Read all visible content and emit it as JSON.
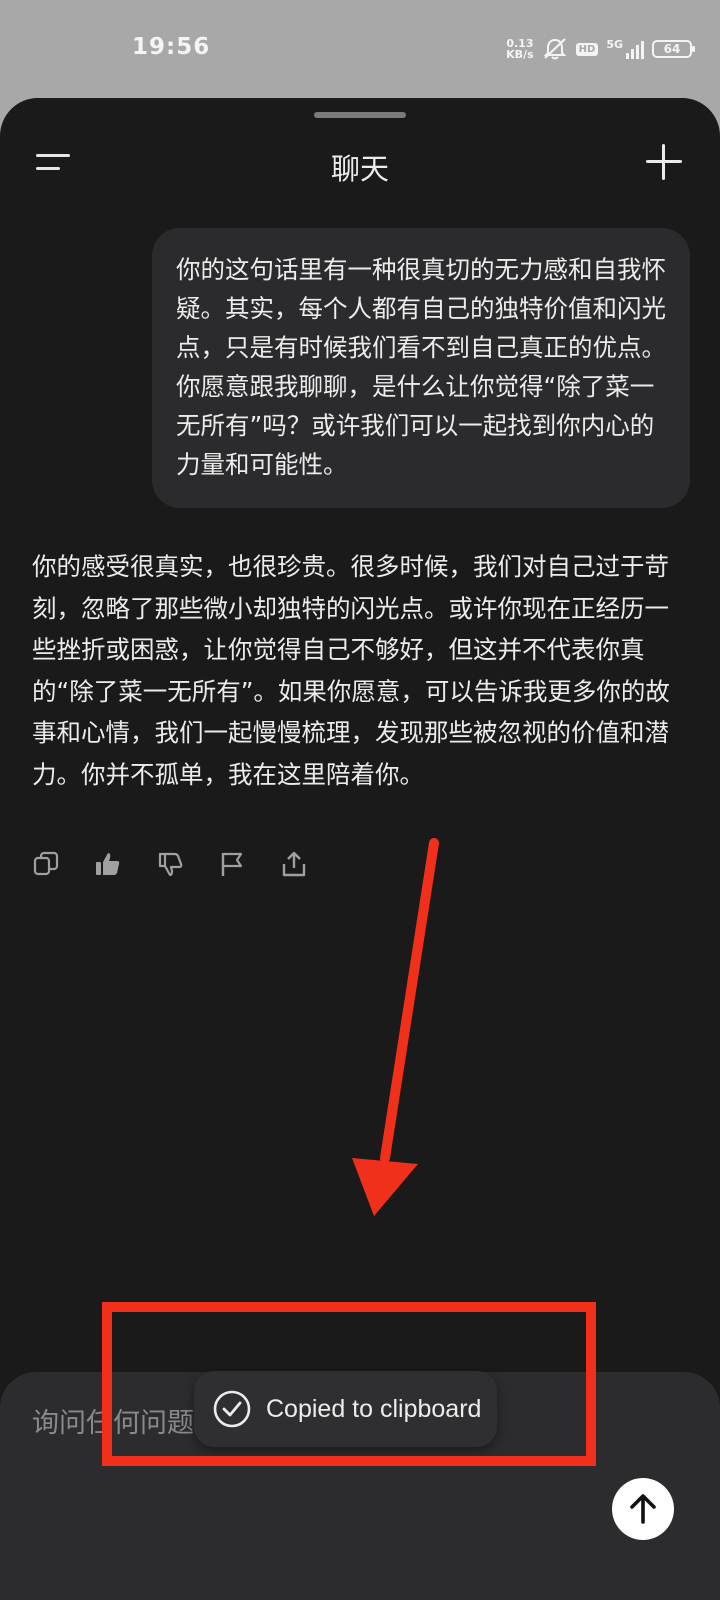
{
  "status_bar": {
    "time": "19:56",
    "net_speed_value": "0.13",
    "net_speed_unit": "KB/s",
    "hd": "HD",
    "network": "5G",
    "battery": "64"
  },
  "header": {
    "title": "聊天"
  },
  "messages": {
    "user": "你的这句话里有一种很真切的无力感和自我怀疑。其实，每个人都有自己的独特价值和闪光点，只是有时候我们看不到自己真正的优点。你愿意跟我聊聊，是什么让你觉得“除了菜一无所有”吗？或许我们可以一起找到你内心的力量和可能性。",
    "assistant": "你的感受很真实，也很珍贵。很多时候，我们对自己过于苛刻，忽略了那些微小却独特的闪光点。或许你现在正经历一些挫折或困惑，让你觉得自己不够好，但这并不代表你真的“除了菜一无所有”。如果你愿意，可以告诉我更多你的故事和心情，我们一起慢慢梳理，发现那些被忽视的价值和潜力。你并不孤单，我在这里陪着你。"
  },
  "message_actions": [
    "copy-icon",
    "thumbs-up-icon",
    "thumbs-down-icon",
    "flag-icon",
    "share-icon"
  ],
  "composer": {
    "placeholder": "询问任何问题"
  },
  "toast": {
    "text": "Copied to clipboard"
  },
  "colors": {
    "background": "#1a1a1b",
    "bubble": "#2b2b2e",
    "annotation": "#f0301a"
  }
}
